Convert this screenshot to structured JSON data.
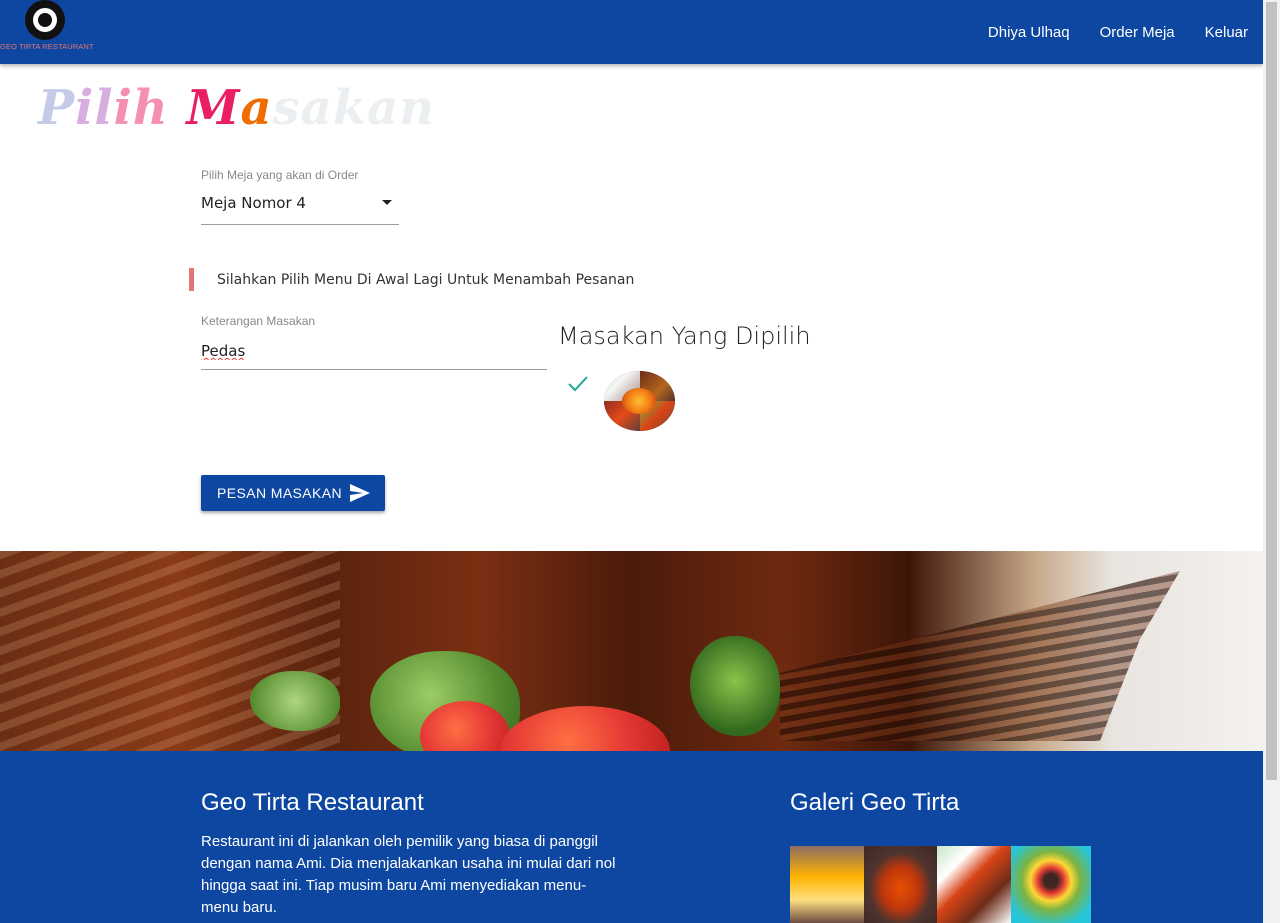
{
  "navbar": {
    "logo_text": "GEO TIRTA RESTAURANT",
    "links": [
      "Dhiya Ulhaq",
      "Order Meja",
      "Keluar"
    ]
  },
  "page_title": {
    "parts": [
      "P",
      "il",
      "ih ",
      "M",
      "a",
      "sakan"
    ]
  },
  "table_select": {
    "label": "Pilih Meja yang akan di Order",
    "value": "Meja Nomor 4"
  },
  "notice": "Silahkan Pilih Menu Di Awal Lagi Untuk Menambah Pesanan",
  "note_field": {
    "label": "Keterangan Masakan",
    "value": "Pedas"
  },
  "selected": {
    "heading": "Masakan Yang Dipilih"
  },
  "order_button": {
    "label": "PESAN MASAKAN"
  },
  "footer": {
    "title": "Geo Tirta Restaurant",
    "text": "Restaurant ini di jalankan oleh pemilik yang biasa di panggil dengan nama Ami. Dia menjalakankan usaha ini mulai dari nol hingga saat ini. Tiap musim baru Ami menyediakan menu-menu baru.",
    "gallery_title": "Galeri Geo Tirta"
  },
  "colors": {
    "primary": "#0d47a1",
    "accent_red": "#e57373",
    "check_teal": "#26a69a"
  }
}
